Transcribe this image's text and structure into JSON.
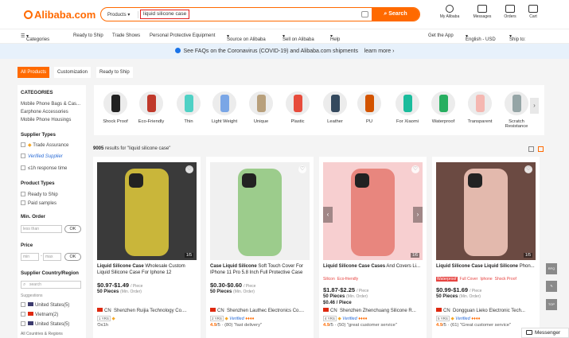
{
  "header": {
    "logo": "Alibaba.com",
    "search_category": "Products",
    "search_query": "liquid silicone case",
    "search_button": "Search",
    "icons": [
      {
        "name": "my-alibaba-icon",
        "label": "My Alibaba"
      },
      {
        "name": "messages-icon",
        "label": "Messages"
      },
      {
        "name": "orders-icon",
        "label": "Orders"
      },
      {
        "name": "cart-icon",
        "label": "Cart"
      }
    ]
  },
  "nav": {
    "categories": "Categories",
    "ready_to_ship": "Ready to Ship",
    "trade_shows": "Trade Shows",
    "ppe": "Personal Protective Equipment",
    "source": "Source on Alibaba",
    "sell": "Sell on Alibaba",
    "help": "Help",
    "get_app": "Get the App",
    "language": "English - USD",
    "ship_to": "Ship to:"
  },
  "notice": {
    "text": "See FAQs on the Coronavirus (COVID-19) and Alibaba.com shipments",
    "link": "learn more"
  },
  "tabs": [
    "All Products",
    "Customization",
    "Ready to Ship"
  ],
  "sidebar": {
    "categories_title": "CATEGORIES",
    "categories": [
      "Mobile Phone Bags & Cas...",
      "Earphone Accessories",
      "Mobile Phone Housings"
    ],
    "supplier_types_title": "Supplier Types",
    "supplier_types": [
      "Trade Assurance",
      "Verified Supplier",
      "≤1h response time"
    ],
    "product_types_title": "Product Types",
    "product_types": [
      "Ready to Ship",
      "Paid samples"
    ],
    "min_order_title": "Min. Order",
    "min_order_placeholder": "less than",
    "ok": "OK",
    "price_title": "Price",
    "price_min": "min",
    "price_max": "max",
    "country_title": "Supplier Country/Region",
    "country_search": "search",
    "suggestions_label": "Suggestions",
    "countries": [
      "United States(5)",
      "Vietnam(2)",
      "United States(5)"
    ],
    "all_countries": "All Countries & Regions"
  },
  "category_strip": [
    {
      "label": "Shock Proof",
      "color": "#222222"
    },
    {
      "label": "Eco-Friendly",
      "color": "#c0392b"
    },
    {
      "label": "Thin",
      "color": "#4fd1c5"
    },
    {
      "label": "Light Weight",
      "color": "#7aa6e6"
    },
    {
      "label": "Unique",
      "color": "#b8a07c"
    },
    {
      "label": "Plastic",
      "color": "#e74c3c"
    },
    {
      "label": "Leather",
      "color": "#34495e"
    },
    {
      "label": "PU",
      "color": "#d35400"
    },
    {
      "label": "For Xiaomi",
      "color": "#1abc9c"
    },
    {
      "label": "Waterproof",
      "color": "#27ae60"
    },
    {
      "label": "Transparent",
      "color": "#f5b7b1"
    },
    {
      "label": "Scratch Resistance",
      "color": "#95a5a6"
    }
  ],
  "results": {
    "count": "9005",
    "text": "results for \"liquid silicone case\""
  },
  "products": [
    {
      "title_bold": "Liquid Silicone Case",
      "title_rest": "Wholesale Custom Liquid Silicone Case For Iphone 12",
      "img_color": "#c9b63a",
      "bg": "#3a3a3a",
      "pager": "1/5",
      "tags": [],
      "price": "$0.97-$1.49",
      "price_unit": "/ Piece",
      "moq": "50 Pieces",
      "moq_note": "(Min. Order)",
      "extra": "",
      "supplier": "Shenzhen Ruijia Technology Co....",
      "years": "1 YRS",
      "rating": "",
      "reviews": "",
      "feedback": "",
      "response": "≤1h"
    },
    {
      "title_bold": "Case Liquid Silicone",
      "title_rest": "Soft Touch Cover For IPhone 11 Pro 5.8 Inch Full Protective Case",
      "img_color": "#9ccc8c",
      "bg": "#f0f0f0",
      "pager": "",
      "tags": [],
      "price": "$0.30-$0.60",
      "price_unit": "/ Piece",
      "moq": "50 Pieces",
      "moq_note": "(Min. Order)",
      "extra": "",
      "supplier": "Shenzhen Lauthec Electronics Co....",
      "years": "2 YRS",
      "rating": "4.9",
      "reviews": "(80)",
      "feedback": "\"fast delivery\"",
      "response": ""
    },
    {
      "title_bold": "Liquid Silicone Case Cases",
      "title_rest": "And Covers Li...",
      "img_color": "#e8867e",
      "bg": "#f7cfd0",
      "pager": "1/6",
      "tags": [
        "Silicon",
        "Eco-friendly"
      ],
      "price": "$1.87-$2.25",
      "price_unit": "/ Piece",
      "moq": "50 Pieces",
      "moq_note": "(Min. Order)",
      "extra": "$0.46 / Piece",
      "supplier": "Shenzhen Zhenchuang Silicone R...",
      "years": "4 YRS",
      "rating": "4.9",
      "reviews": "(50)",
      "feedback": "\"great customer service\"",
      "response": ""
    },
    {
      "title_bold": "Liquid Silicone Case Liquid Silicone",
      "title_rest": "Phon...",
      "img_color": "#e3b9ad",
      "bg": "#6b4a42",
      "pager": "1/5",
      "tags": [
        "Waterproof",
        "Full Cover",
        "Iphone",
        "Shock Proof"
      ],
      "price": "$0.99-$1.69",
      "price_unit": "/ Piece",
      "moq": "50 Pieces",
      "moq_note": "(Min. Order)",
      "extra": "",
      "supplier": "Dongguan Lieko Electronic Tech...",
      "years": "5 YRS",
      "rating": "4.9",
      "reviews": "(61)",
      "feedback": "\"Great customer service\"",
      "response": ""
    }
  ],
  "float_buttons": [
    "RFQ",
    "",
    "TOP"
  ],
  "messenger": "Messenger"
}
